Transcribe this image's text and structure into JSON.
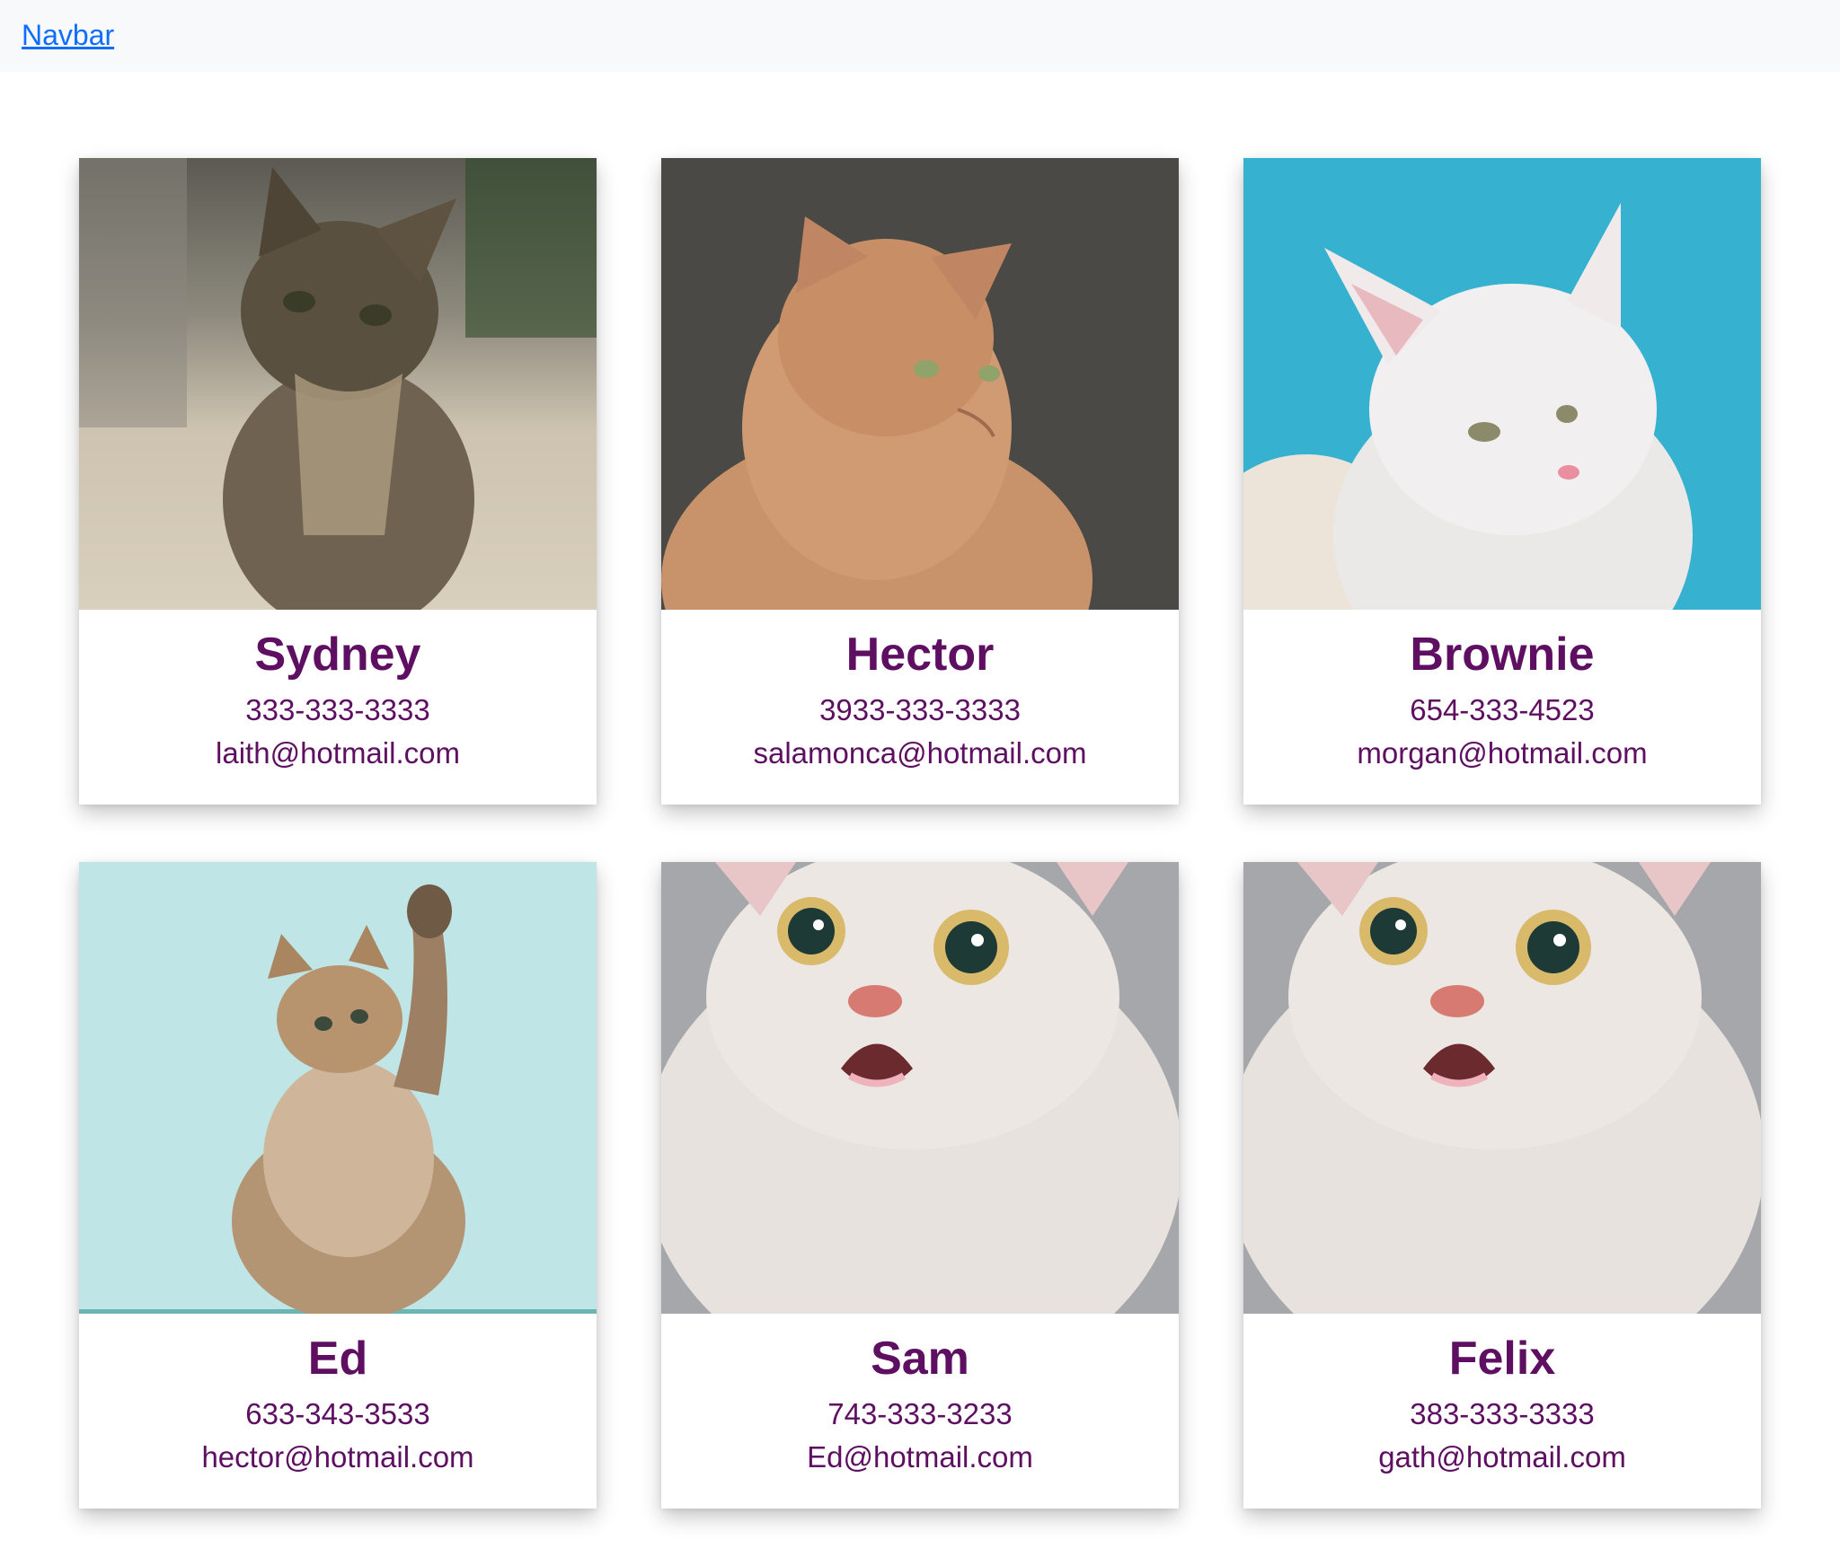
{
  "navbar": {
    "brand_label": "Navbar"
  },
  "cards": [
    {
      "name": "Sydney",
      "phone": "333-333-3333",
      "email": "laith@hotmail.com",
      "photo": "tabby-kitten-photo"
    },
    {
      "name": "Hector",
      "phone": "3933-333-3333",
      "email": "salamonca@hotmail.com",
      "photo": "orange-maine-coon-photo"
    },
    {
      "name": "Brownie",
      "phone": "654-333-4523",
      "email": "morgan@hotmail.com",
      "photo": "white-cat-blue-background-photo"
    },
    {
      "name": "Ed",
      "phone": "633-343-3533",
      "email": "hector@hotmail.com",
      "photo": "kitten-reaching-up-photo"
    },
    {
      "name": "Sam",
      "phone": "743-333-3233",
      "email": "Ed@hotmail.com",
      "photo": "surprised-white-cat-photo"
    },
    {
      "name": "Felix",
      "phone": "383-333-3333",
      "email": "gath@hotmail.com",
      "photo": "surprised-white-cat-photo"
    }
  ],
  "colors": {
    "navbar_bg": "#f8f9fa",
    "link": "#0d6efd",
    "card_text": "#5e0f62"
  }
}
